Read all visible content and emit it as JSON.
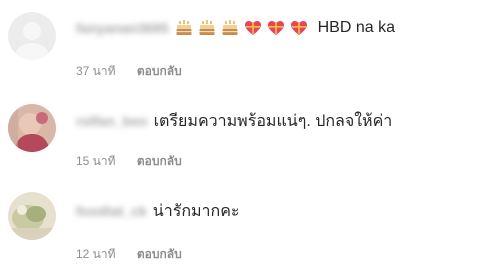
{
  "comments": [
    {
      "username": "fanyanan3695",
      "emoji_icons": [
        "birthday-cake-icon",
        "birthday-cake-icon",
        "birthday-cake-icon",
        "heart-gift-icon",
        "heart-gift-icon",
        "heart-gift-icon"
      ],
      "text": "HBD na ka",
      "time": "37 นาที",
      "reply_label": "ตอบกลับ"
    },
    {
      "username": "rolfan_beo",
      "text": "เตรียมความพร้อมแน่ๆ. ปกลจให้ค่า",
      "time": "15 นาที",
      "reply_label": "ตอบกลับ"
    },
    {
      "username": "foodtat_ck",
      "text": "น่ารักมากคะ",
      "time": "12 นาที",
      "reply_label": "ตอบกลับ"
    }
  ],
  "colors": {
    "text": "#262626",
    "meta": "#8e8e8e",
    "background": "#ffffff"
  }
}
